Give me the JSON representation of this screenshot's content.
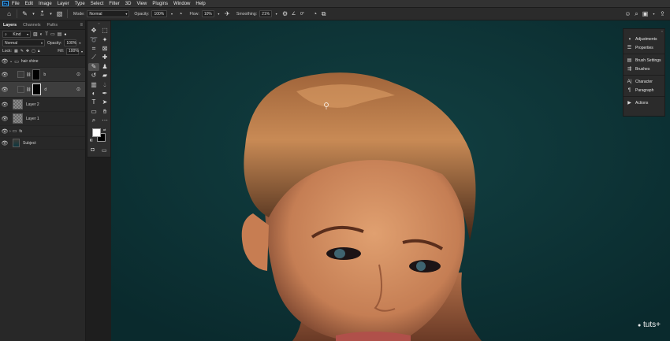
{
  "menubar": {
    "app_icon": "Ps",
    "items": [
      "File",
      "Edit",
      "Image",
      "Layer",
      "Type",
      "Select",
      "Filter",
      "3D",
      "View",
      "Plugins",
      "Window",
      "Help"
    ]
  },
  "options_bar": {
    "brush_size": "30",
    "mode_label": "Mode:",
    "mode_value": "Normal",
    "opacity_label": "Opacity:",
    "opacity_value": "100%",
    "flow_label": "Flow:",
    "flow_value": "10%",
    "smoothing_label": "Smoothing:",
    "smoothing_value": "21%",
    "angle_value": "0°"
  },
  "layers_panel": {
    "tabs": [
      "Layers",
      "Channels",
      "Paths"
    ],
    "filter_kind": "Kind",
    "blend_mode": "Normal",
    "opacity_label": "Opacity:",
    "opacity_value": "100%",
    "lock_label": "Lock:",
    "fill_label": "Fill:",
    "fill_value": "100%",
    "layers": [
      {
        "name": "hair shine",
        "type": "group"
      },
      {
        "name": "b",
        "type": "adjustment"
      },
      {
        "name": "d",
        "type": "adjustment"
      },
      {
        "name": "Layer 2",
        "type": "pixel"
      },
      {
        "name": "Layer 1",
        "type": "pixel"
      },
      {
        "name": "fs",
        "type": "group"
      },
      {
        "name": "Subject",
        "type": "pixel"
      }
    ]
  },
  "right_panel": {
    "items": [
      {
        "label": "Adjustments",
        "icon": "adjustments-icon"
      },
      {
        "label": "Properties",
        "icon": "properties-icon"
      },
      {
        "label": "Brush Settings",
        "icon": "brush-settings-icon"
      },
      {
        "label": "Brushes",
        "icon": "brushes-icon"
      },
      {
        "label": "Character",
        "icon": "character-icon"
      },
      {
        "label": "Paragraph",
        "icon": "paragraph-icon"
      },
      {
        "label": "Actions",
        "icon": "actions-icon"
      }
    ]
  },
  "watermark": "tuts+",
  "colors": {
    "canvas_bg": "#0e3639",
    "panel_bg": "#282828",
    "accent": "#31a8ff"
  }
}
